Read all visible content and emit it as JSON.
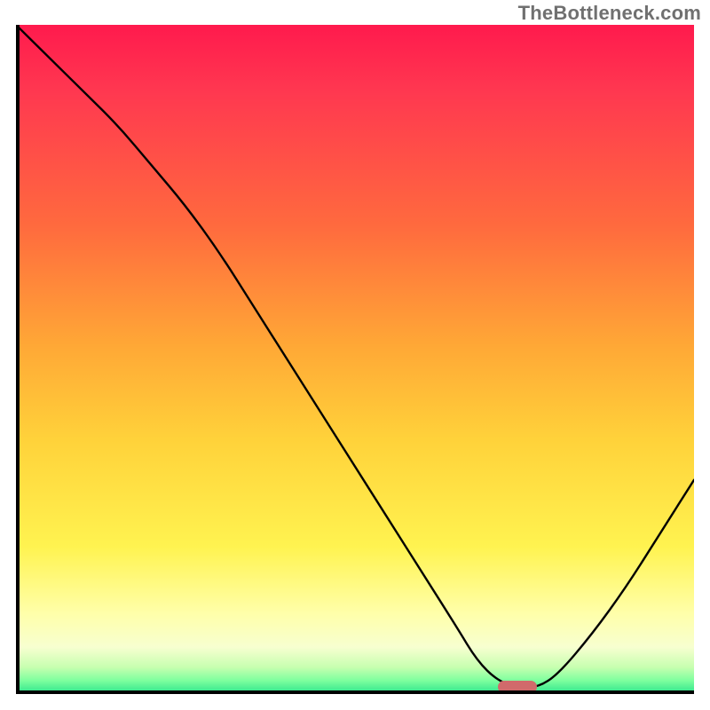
{
  "watermark": "TheBottleneck.com",
  "colors": {
    "curve": "#000000",
    "marker": "#d16a6b",
    "gradient_top": "#ff1a4d",
    "gradient_bottom": "#29e38b",
    "axes": "#000000",
    "watermark": "#707070"
  },
  "chart_data": {
    "type": "line",
    "title": "",
    "xlabel": "",
    "ylabel": "",
    "xlim": [
      0,
      100
    ],
    "ylim": [
      0,
      100
    ],
    "grid": false,
    "legend": "none",
    "x": [
      0,
      5,
      10,
      15,
      20,
      25,
      30,
      35,
      40,
      45,
      50,
      55,
      60,
      65,
      68,
      71,
      74,
      77,
      80,
      85,
      90,
      95,
      100
    ],
    "values": [
      100,
      95,
      90,
      85,
      79,
      73,
      66,
      58,
      50,
      42,
      34,
      26,
      18,
      10,
      5,
      2,
      1,
      1,
      3,
      9,
      16,
      24,
      32
    ],
    "marker": {
      "x": 74,
      "y": 1
    },
    "note": "x is relative horizontal position (0=left axis, 100=right edge); values are relative height (0=bottom axis, 100=top). Curve starts at top-left, bends near x≈25, descends to a near-zero plateau around x≈71–77, then rises toward the right."
  }
}
